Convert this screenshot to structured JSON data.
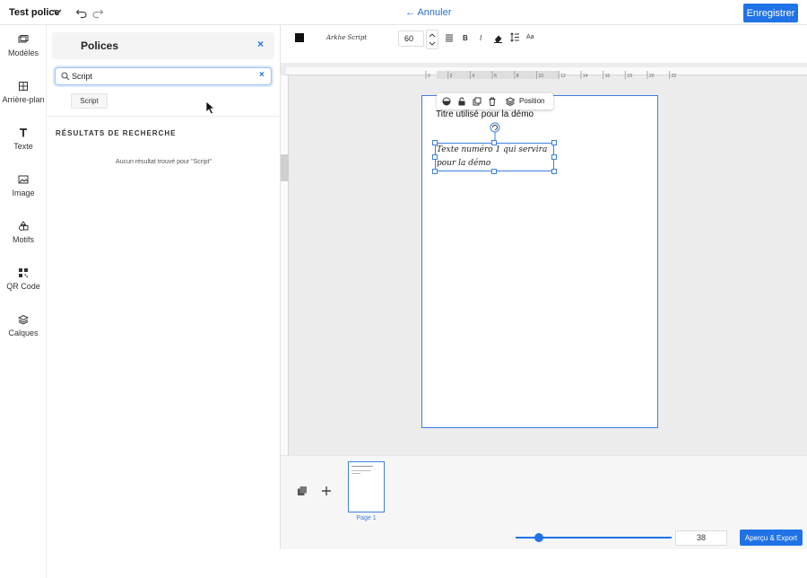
{
  "header": {
    "doc_title": "Test police",
    "cancel_label": "Annuler",
    "save_label": "Enregistrer"
  },
  "rail": {
    "items": [
      {
        "label": "Modèles",
        "icon": "templates-icon"
      },
      {
        "label": "Arrière-plan",
        "icon": "background-icon"
      },
      {
        "label": "Texte",
        "icon": "text-icon"
      },
      {
        "label": "Image",
        "icon": "image-icon"
      },
      {
        "label": "Motifs",
        "icon": "shapes-icon"
      },
      {
        "label": "QR Code",
        "icon": "qr-code-icon"
      },
      {
        "label": "Calques",
        "icon": "layers-icon"
      }
    ]
  },
  "fonts_panel": {
    "title": "Polices",
    "close_symbol": "×",
    "search_value": "Script",
    "clear_symbol": "×",
    "chip_label": "Script",
    "results_title": "RÉSULTATS DE RECHERCHE",
    "no_results": "Aucun résultat trouvé pour \"Script\""
  },
  "text_toolbar": {
    "color": "#111111",
    "font_name": "Arkhe Script",
    "font_size": "60",
    "bold": "B",
    "italic": "I",
    "case": "Aa"
  },
  "ruler": {
    "ticks": [
      "0",
      "2",
      "4",
      "6",
      "8",
      "10",
      "12",
      "14",
      "16",
      "18",
      "20",
      "22"
    ]
  },
  "canvas": {
    "ctx_position_label": "Position",
    "heading_text": "Titre utilisé pour la démo",
    "selected_text": "Texte numéro 1 qui servira pour la démo"
  },
  "pages": {
    "thumb_label": "Page 1"
  },
  "footer": {
    "zoom_value": "38",
    "zoom_fraction": 0.15,
    "export_label": "Aperçu & Export"
  },
  "colors": {
    "accent": "#1f73e6",
    "selection": "#3d7fdf"
  }
}
